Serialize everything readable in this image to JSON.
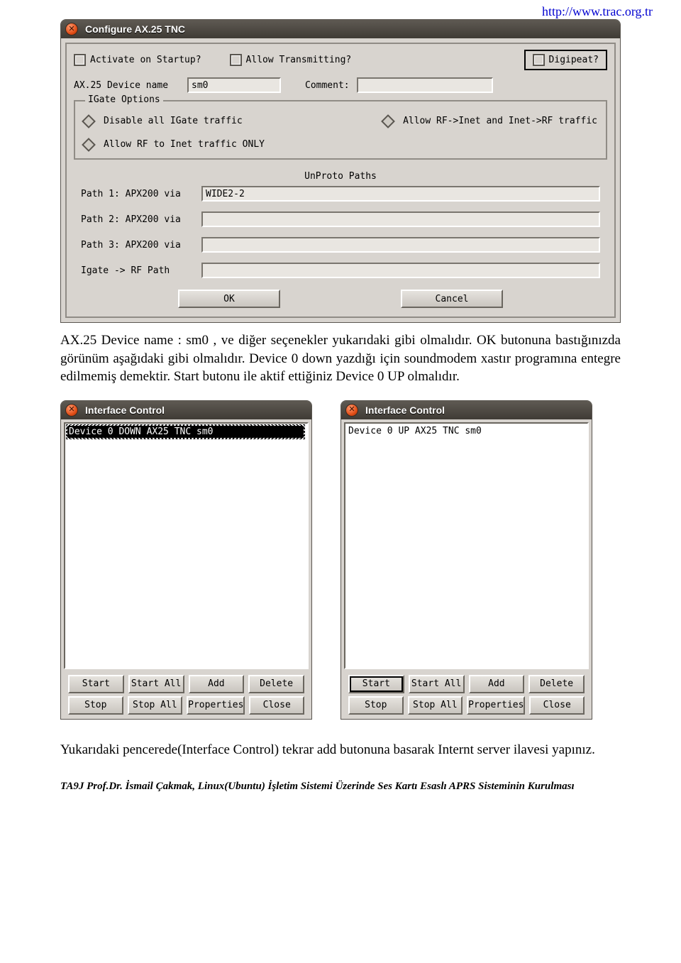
{
  "header_url": "http://www.trac.org.tr",
  "config_window": {
    "title": "Configure AX.25 TNC",
    "activate_label": "Activate on Startup?",
    "allow_tx_label": "Allow Transmitting?",
    "digipeat_label": "Digipeat?",
    "device_name_label": "AX.25 Device name",
    "device_name_value": "sm0",
    "comment_label": "Comment:",
    "comment_value": "",
    "igate_group_label": "IGate Options",
    "igate_opt1": "Disable all IGate traffic",
    "igate_opt2": "Allow RF->Inet and Inet->RF traffic",
    "igate_opt3": "Allow RF to Inet traffic ONLY",
    "unproto_header": "UnProto Paths",
    "path1_label": "Path 1: APX200 via",
    "path1_value": "WIDE2-2",
    "path2_label": "Path 2: APX200 via",
    "path2_value": "",
    "path3_label": "Path 3: APX200 via",
    "path3_value": "",
    "igate_rf_label": "Igate -> RF Path",
    "igate_rf_value": "",
    "ok_label": "OK",
    "cancel_label": "Cancel"
  },
  "paragraph1": "AX.25 Device name : sm0 , ve diğer seçenekler yukarıdaki gibi olmalıdır. OK butonuna bastığınızda görünüm aşağıdaki gibi olmalıdır. Device 0 down yazdığı için soundmodem xastır programına entegre edilmemiş demektir. Start butonu ile aktif ettiğiniz  Device 0 UP olmalıdır.",
  "interface_control": {
    "title": "Interface Control",
    "left_item": "Device  0   DOWN   AX25 TNC sm0",
    "right_item": "Device  0   UP    AX25 TNC sm0",
    "btn_start": "Start",
    "btn_start_all": "Start All",
    "btn_add": "Add",
    "btn_delete": "Delete",
    "btn_stop": "Stop",
    "btn_stop_all": "Stop All",
    "btn_properties": "Properties",
    "btn_close": "Close"
  },
  "paragraph2": "Yukarıdaki pencerede(Interface Control) tekrar add butonuna basarak  Internt server ilavesi yapınız.",
  "footer": "TA9J Prof.Dr. İsmail Çakmak,  Linux(Ubuntu) İşletim Sistemi Üzerinde Ses Kartı Esaslı APRS Sisteminin Kurulması"
}
